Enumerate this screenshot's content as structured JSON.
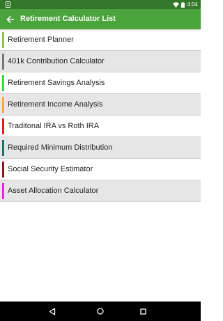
{
  "status_bar": {
    "time": "4:04"
  },
  "app_bar": {
    "title": "Retirement Calculator List"
  },
  "items": [
    {
      "label": "Retirement Planner",
      "color": "#8bc34a"
    },
    {
      "label": "401k Contribution Calculator",
      "color": "#757575"
    },
    {
      "label": "Retirement Savings Analysis",
      "color": "#33dd33"
    },
    {
      "label": "Retirement Income Analysis",
      "color": "#f5a742"
    },
    {
      "label": "Traditonal IRA vs Roth IRA",
      "color": "#e11d1d"
    },
    {
      "label": "Required Minimum Distribution",
      "color": "#1f7070"
    },
    {
      "label": "Social Security Estimator",
      "color": "#8b1a1a"
    },
    {
      "label": "Asset Allocation Calculator",
      "color": "#ee22dd"
    }
  ],
  "colors": {
    "status_bar": "#33772a",
    "app_bar": "#4ba33c",
    "alt_row": "#e6e6e6",
    "nav_bar": "#000000"
  }
}
